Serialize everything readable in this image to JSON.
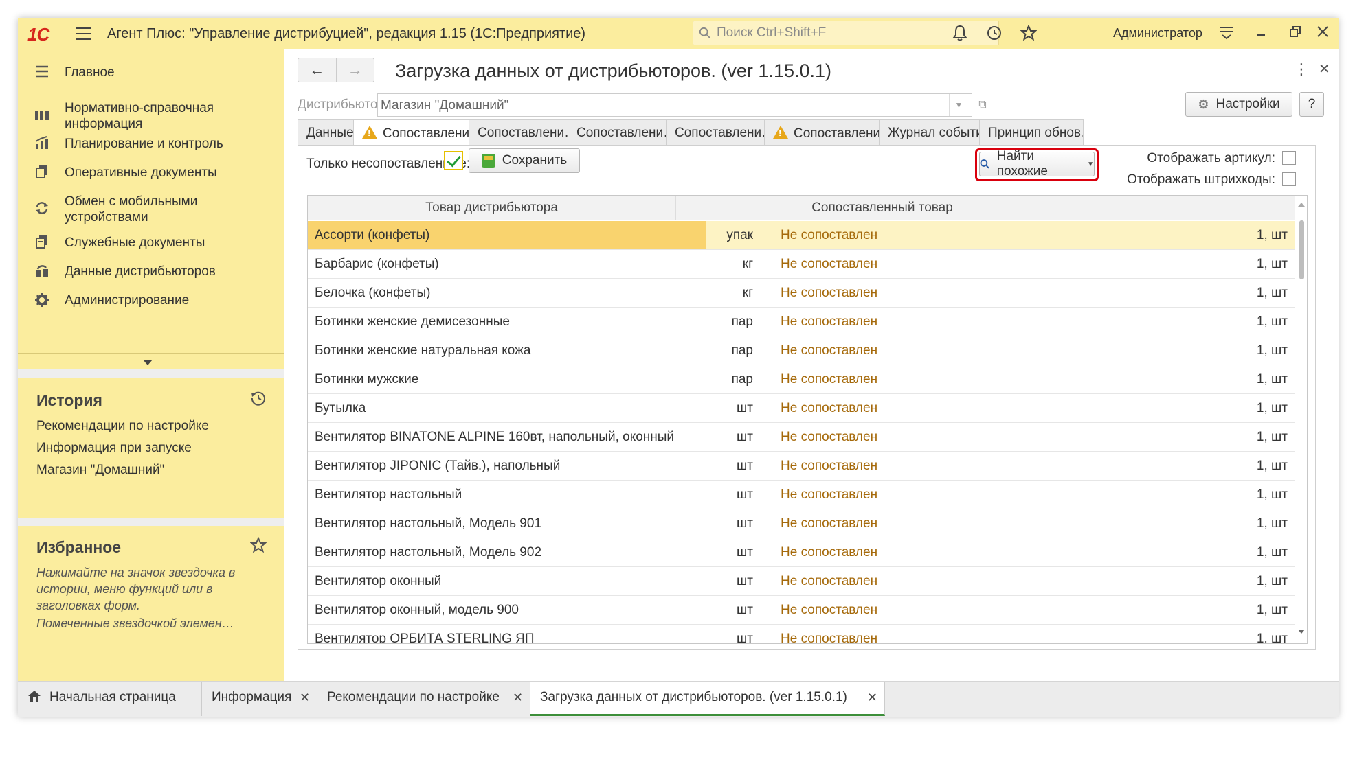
{
  "app": {
    "logo": "1С",
    "title": "Агент Плюс: \"Управление дистрибуцией\", редакция 1.15  (1С:Предприятие)",
    "search_placeholder": "Поиск Ctrl+Shift+F",
    "user": "Администратор"
  },
  "sidebar": {
    "items": [
      {
        "label": "Главное",
        "icon": "menu-lines-icon"
      },
      {
        "label": "Нормативно-справочная информация",
        "icon": "catalog-icon"
      },
      {
        "label": "Планирование и контроль",
        "icon": "chart-icon"
      },
      {
        "label": "Оперативные документы",
        "icon": "documents-icon"
      },
      {
        "label": "Обмен с мобильными устройствами",
        "icon": "sync-icon"
      },
      {
        "label": "Служебные документы",
        "icon": "service-docs-icon"
      },
      {
        "label": "Данные дистрибьюторов",
        "icon": "distributor-data-icon"
      },
      {
        "label": "Администрирование",
        "icon": "gear-icon"
      }
    ],
    "history": {
      "title": "История",
      "links": [
        "Рекомендации по настройке",
        "Информация при запуске",
        "Магазин \"Домашний\""
      ]
    },
    "favorites": {
      "title": "Избранное",
      "hint": "Нажимайте на значок звездочка в истории, меню функций или в заголовках форм.",
      "hint2": "Помеченные звездочкой элемен…"
    }
  },
  "form": {
    "title": "Загрузка данных от дистрибьюторов. (ver 1.15.0.1)",
    "distributor_label": "Дистрибьютор:",
    "distributor_value": "Магазин \"Домашний\"",
    "settings_button": "Настройки",
    "help_button": "?",
    "tabs": [
      {
        "label": "Данные",
        "warn": false
      },
      {
        "label": "Сопоставлени…",
        "warn": true
      },
      {
        "label": "Сопоставлени…",
        "warn": false
      },
      {
        "label": "Сопоставлени…",
        "warn": false
      },
      {
        "label": "Сопоставлени…",
        "warn": false
      },
      {
        "label": "Сопоставлени…",
        "warn": true
      },
      {
        "label": "Журнал событий",
        "warn": false
      },
      {
        "label": "Принцип обнов…",
        "warn": false
      }
    ],
    "only_unmatched_label": "Только несопоставленные:",
    "only_unmatched_checked": true,
    "save_button": "Сохранить",
    "find_similar_button": "Найти похожие",
    "show_article_label": "Отображать артикул:",
    "show_barcodes_label": "Отображать штрихкоды:",
    "columns": {
      "distributor_product": "Товар дистрибьютора",
      "matched_product": "Сопоставленный товар"
    },
    "rows": [
      {
        "name": "Ассорти (конфеты)",
        "unit": "упак",
        "match": "Не сопоставлен",
        "qty": "1, шт"
      },
      {
        "name": "Барбарис (конфеты)",
        "unit": "кг",
        "match": "Не сопоставлен",
        "qty": "1, шт"
      },
      {
        "name": "Белочка (конфеты)",
        "unit": "кг",
        "match": "Не сопоставлен",
        "qty": "1, шт"
      },
      {
        "name": "Ботинки женские демисезонные",
        "unit": "пар",
        "match": "Не сопоставлен",
        "qty": "1, шт"
      },
      {
        "name": "Ботинки женские натуральная кожа",
        "unit": "пар",
        "match": "Не сопоставлен",
        "qty": "1, шт"
      },
      {
        "name": "Ботинки мужские",
        "unit": "пар",
        "match": "Не сопоставлен",
        "qty": "1, шт"
      },
      {
        "name": "Бутылка",
        "unit": "шт",
        "match": "Не сопоставлен",
        "qty": "1, шт"
      },
      {
        "name": "Вентилятор BINATONE ALPINE 160вт, напольный, оконный",
        "unit": "шт",
        "match": "Не сопоставлен",
        "qty": "1, шт"
      },
      {
        "name": "Вентилятор JIPONIC (Тайв.), напольный",
        "unit": "шт",
        "match": "Не сопоставлен",
        "qty": "1, шт"
      },
      {
        "name": "Вентилятор настольный",
        "unit": "шт",
        "match": "Не сопоставлен",
        "qty": "1, шт"
      },
      {
        "name": "Вентилятор настольный, Модель 901",
        "unit": "шт",
        "match": "Не сопоставлен",
        "qty": "1, шт"
      },
      {
        "name": "Вентилятор настольный, Модель 902",
        "unit": "шт",
        "match": "Не сопоставлен",
        "qty": "1, шт"
      },
      {
        "name": "Вентилятор оконный",
        "unit": "шт",
        "match": "Не сопоставлен",
        "qty": "1, шт"
      },
      {
        "name": "Вентилятор оконный, модель 900",
        "unit": "шт",
        "match": "Не сопоставлен",
        "qty": "1, шт"
      },
      {
        "name": "Вентилятор ОРБИТА STERLING ЯП",
        "unit": "шт",
        "match": "Не сопоставлен",
        "qty": "1, шт"
      }
    ]
  },
  "taskbar": {
    "items": [
      {
        "label": "Начальная страница",
        "closable": false
      },
      {
        "label": "Информация",
        "closable": true
      },
      {
        "label": "Рекомендации по настройке",
        "closable": true
      },
      {
        "label": "Загрузка данных от дистрибьюторов. (ver 1.15.0.1)",
        "closable": true
      }
    ]
  },
  "colors": {
    "accent_yellow": "#fbed9e",
    "selected_row": "#f9d36e",
    "unmatched_text": "#a5690a",
    "highlight_red": "#d9000d",
    "active_tab_underline": "#3d8f3a"
  }
}
